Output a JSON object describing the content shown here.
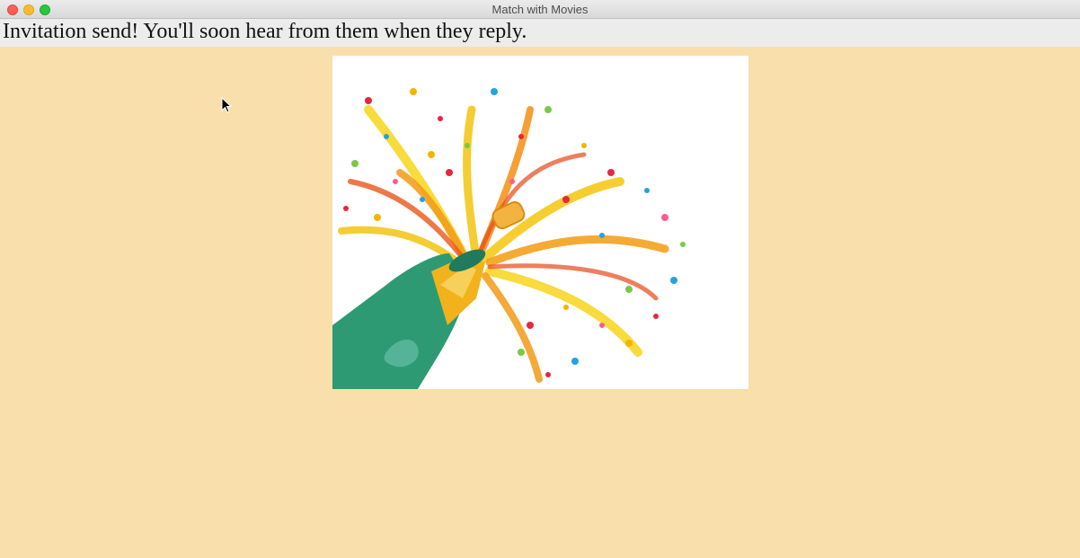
{
  "window": {
    "title": "Match with Movies"
  },
  "message": {
    "text": "Invitation send! You'll soon hear from them when they reply."
  },
  "image": {
    "subject": "champagne-bottle-celebration",
    "alt": ""
  },
  "colors": {
    "background": "#f8dfab",
    "message_bar": "#ececec",
    "bottle_green": "#2e9a74",
    "bottle_gold": "#f2b21b"
  }
}
